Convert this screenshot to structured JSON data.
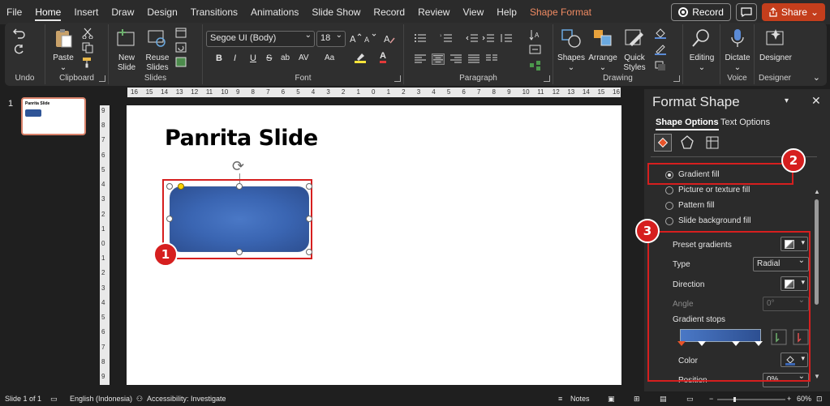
{
  "menu": {
    "tabs": [
      "File",
      "Home",
      "Insert",
      "Draw",
      "Design",
      "Transitions",
      "Animations",
      "Slide Show",
      "Record",
      "Review",
      "View",
      "Help",
      "Shape Format"
    ],
    "record_label": "Record",
    "share_label": "Share"
  },
  "ribbon": {
    "groups": {
      "undo": "Undo",
      "clipboard": "Clipboard",
      "slides": "Slides",
      "font": "Font",
      "paragraph": "Paragraph",
      "drawing": "Drawing",
      "voice": "Voice",
      "designer": "Designer"
    },
    "buttons": {
      "paste": "Paste",
      "new_slide_1": "New",
      "new_slide_2": "Slide",
      "reuse_1": "Reuse",
      "reuse_2": "Slides",
      "shapes": "Shapes",
      "arrange": "Arrange",
      "quick_styles_1": "Quick",
      "quick_styles_2": "Styles",
      "editing": "Editing",
      "dictate": "Dictate",
      "designer": "Designer"
    },
    "font_name": "Segoe UI (Body)",
    "font_size": "18",
    "format_glyphs": [
      "B",
      "I",
      "U",
      "S",
      "ab",
      "AV",
      "Aa",
      "A"
    ]
  },
  "thumbnails": {
    "slide_number": "1",
    "thumb_title": "Panrita Slide"
  },
  "rulers": {
    "horizontal": [
      "16",
      "15",
      "14",
      "13",
      "12",
      "11",
      "10",
      "9",
      "8",
      "7",
      "6",
      "5",
      "4",
      "3",
      "2",
      "1",
      "0",
      "1",
      "2",
      "3",
      "4",
      "5",
      "6",
      "7",
      "8",
      "9",
      "10",
      "11",
      "12",
      "13",
      "14",
      "15",
      "16"
    ],
    "vertical": [
      "9",
      "8",
      "7",
      "6",
      "5",
      "4",
      "3",
      "2",
      "1",
      "0",
      "1",
      "2",
      "3",
      "4",
      "5",
      "6",
      "7",
      "8",
      "9"
    ]
  },
  "slide": {
    "title": "Panrita Slide"
  },
  "annotations": {
    "badge1": "1",
    "badge2": "2",
    "badge3": "3"
  },
  "format_pane": {
    "title": "Format Shape",
    "tab_shape_options": "Shape Options",
    "tab_text_options": "Text Options",
    "fill_options": [
      {
        "label": "Gradient fill",
        "selected": true
      },
      {
        "label": "Picture or texture fill",
        "selected": false
      },
      {
        "label": "Pattern fill",
        "selected": false
      },
      {
        "label": "Slide background fill",
        "selected": false
      }
    ],
    "preset_gradients": "Preset gradients",
    "type_label": "Type",
    "type_value": "Radial",
    "direction_label": "Direction",
    "angle_label": "Angle",
    "angle_value": "0°",
    "gradient_stops_label": "Gradient stops",
    "color_label": "Color",
    "position_label": "Position",
    "position_value": "0%"
  },
  "statusbar": {
    "slide_info": "Slide 1 of 1",
    "language": "English (Indonesia)",
    "accessibility": "Accessibility: Investigate",
    "notes": "Notes",
    "zoom": "60%"
  },
  "colors": {
    "accent": "#c43e1c",
    "annotation_red": "#d61f1f",
    "shape_fill": "#3a65b2"
  }
}
